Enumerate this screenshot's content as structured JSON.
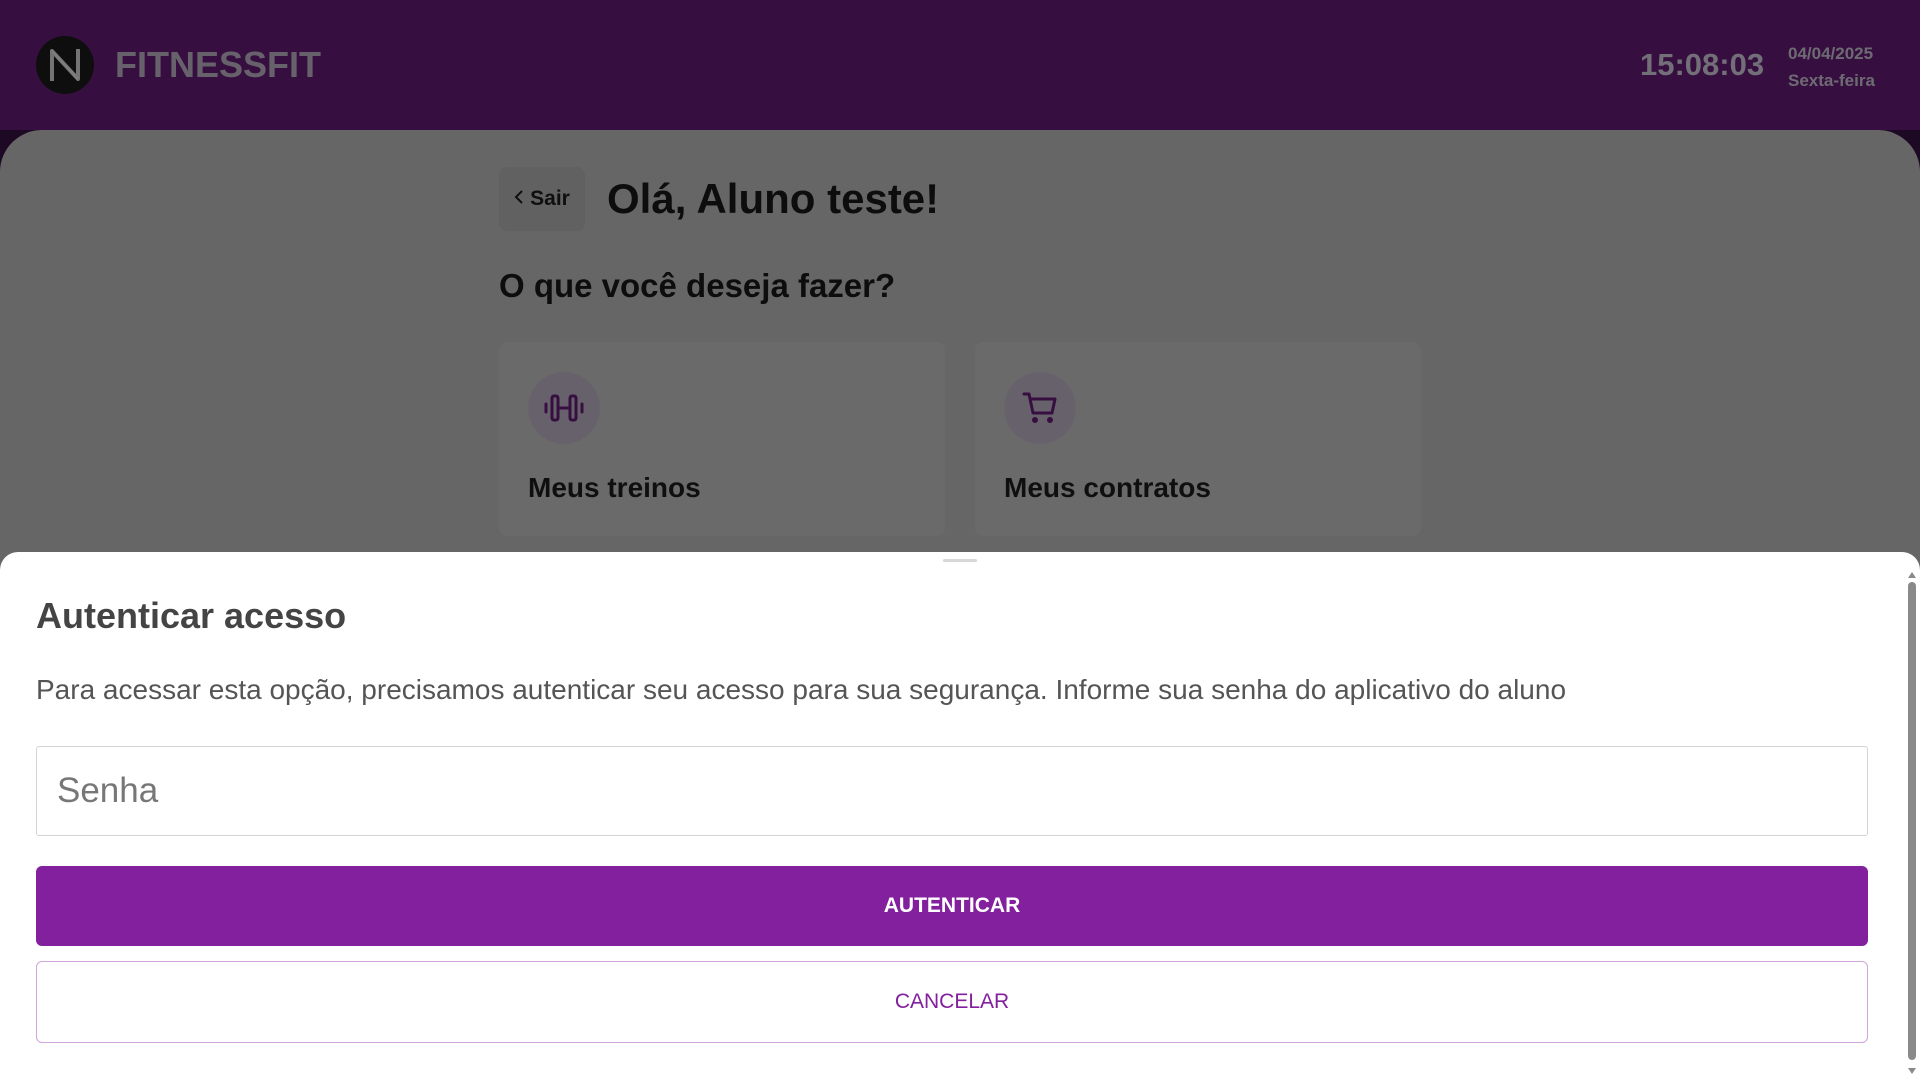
{
  "header": {
    "brand": "FITNESSFIT",
    "time": "15:08:03",
    "date": "04/04/2025",
    "weekday": "Sexta-feira"
  },
  "main": {
    "back_label": "Sair",
    "greeting": "Olá, Aluno teste!",
    "question": "O que você deseja fazer?",
    "cards": [
      {
        "label": "Meus treinos",
        "icon": "dumbbell-icon"
      },
      {
        "label": "Meus contratos",
        "icon": "shopping-cart-icon"
      }
    ]
  },
  "auth_sheet": {
    "title": "Autenticar acesso",
    "description": "Para acessar esta opção, precisamos autenticar seu acesso para sua segurança. Informe sua senha do aplicativo do aluno",
    "password_placeholder": "Senha",
    "password_value": "",
    "authenticate_label": "AUTENTICAR",
    "cancel_label": "CANCELAR"
  },
  "colors": {
    "brand_purple": "#83209e",
    "header_purple": "#6c1f80",
    "icon_purple": "#6c1f80"
  }
}
